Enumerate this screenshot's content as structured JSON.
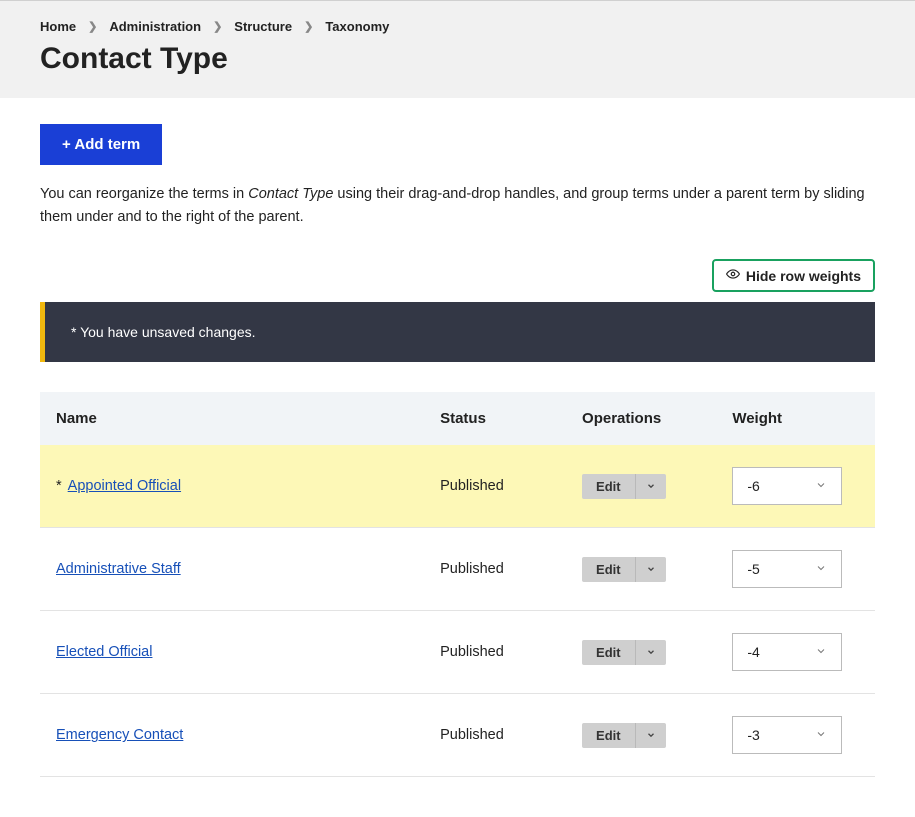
{
  "breadcrumb": {
    "home": "Home",
    "administration": "Administration",
    "structure": "Structure",
    "taxonomy": "Taxonomy"
  },
  "page_title": "Contact Type",
  "add_term_label": "+ Add term",
  "help_text_prefix": "You can reorganize the terms in ",
  "help_text_emph": "Contact Type",
  "help_text_suffix": " using their drag-and-drop handles, and group terms under a parent term by sliding them under and to the right of the parent.",
  "hide_weights_label": "Hide row weights",
  "alert_text": "* You have unsaved changes.",
  "table": {
    "headers": {
      "name": "Name",
      "status": "Status",
      "operations": "Operations",
      "weight": "Weight"
    },
    "edit_label": "Edit",
    "rows": [
      {
        "marker": "*",
        "name": "Appointed Official",
        "status": "Published",
        "weight": "-6",
        "modified": true
      },
      {
        "marker": "",
        "name": "Administrative Staff",
        "status": "Published",
        "weight": "-5",
        "modified": false
      },
      {
        "marker": "",
        "name": "Elected Official",
        "status": "Published",
        "weight": "-4",
        "modified": false
      },
      {
        "marker": "",
        "name": "Emergency Contact",
        "status": "Published",
        "weight": "-3",
        "modified": false
      }
    ]
  }
}
